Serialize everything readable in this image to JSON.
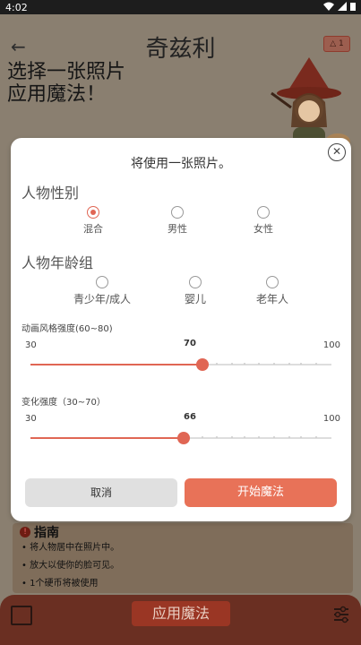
{
  "status": {
    "time": "4:02"
  },
  "app": {
    "title": "奇兹利",
    "coin_badge": "1",
    "intro_line1": "选择一张照片",
    "intro_line2": "应用魔法！"
  },
  "guide": {
    "title": "指南",
    "items": [
      "将人物居中在照片中。",
      "放大以使你的脸可见。",
      "1个硬币将被使用"
    ]
  },
  "bottom": {
    "apply_label": "应用魔法"
  },
  "modal": {
    "title": "将使用一张照片。",
    "gender_title": "人物性别",
    "gender_options": [
      "混合",
      "男性",
      "女性"
    ],
    "gender_selected": "混合",
    "age_title": "人物年龄组",
    "age_options": [
      "青少年/成人",
      "婴儿",
      "老年人"
    ],
    "anime_label": "动画风格强度(60~80)",
    "anime_min": "30",
    "anime_max": "100",
    "anime_value": "70",
    "change_label": "变化强度（30~70）",
    "change_min": "30",
    "change_max": "100",
    "change_value": "66",
    "cancel_label": "取消",
    "start_label": "开始魔法"
  },
  "colors": {
    "accent": "#e87258",
    "radio_on": "#e06654"
  }
}
